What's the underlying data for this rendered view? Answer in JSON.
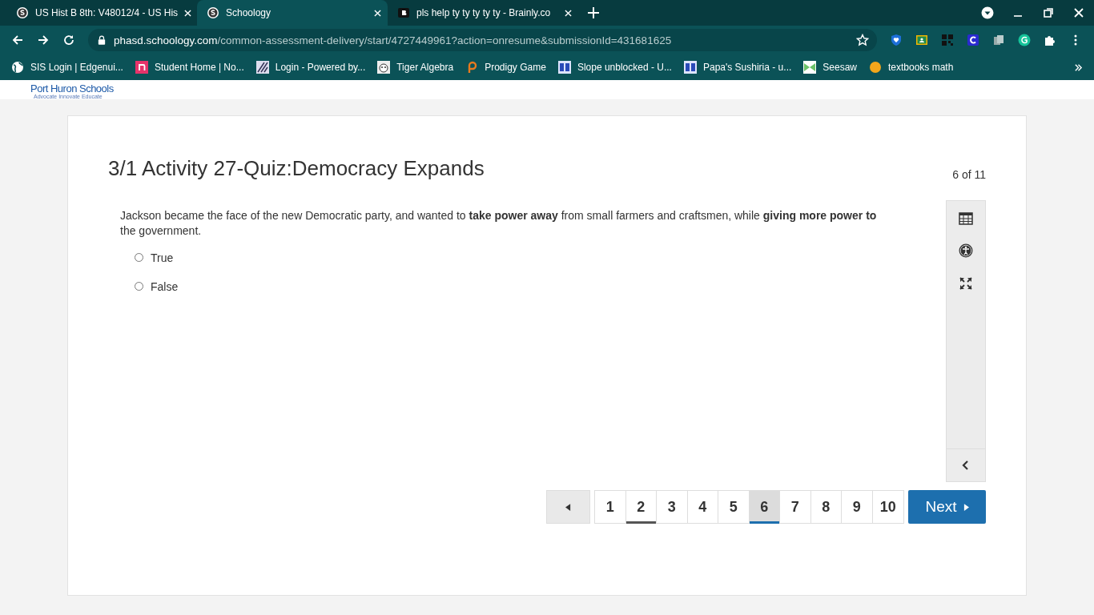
{
  "browser": {
    "tabs": [
      {
        "title": "US Hist B 8th: V48012/4 - US His",
        "selected": false
      },
      {
        "title": "Schoology",
        "selected": true
      },
      {
        "title": "pls help ty ty ty ty ty - Brainly.co",
        "selected": false
      }
    ],
    "url_host": "phasd.schoology.com",
    "url_path": "/common-assessment-delivery/start/4727449961?action=onresume&submissionId=431681625",
    "bookmarks": [
      {
        "label": "SIS Login | Edgenui..."
      },
      {
        "label": "Student Home | No..."
      },
      {
        "label": "Login - Powered by..."
      },
      {
        "label": "Tiger Algebra"
      },
      {
        "label": "Prodigy Game"
      },
      {
        "label": "Slope unblocked - U..."
      },
      {
        "label": "Papa's Sushiria - u..."
      },
      {
        "label": "Seesaw"
      },
      {
        "label": "textbooks math"
      }
    ]
  },
  "header": {
    "school": "Port Huron Schools",
    "motto": "Advocate  Innovate  Educate"
  },
  "quiz": {
    "title": "3/1 Activity 27-Quiz:Democracy Expands",
    "progress": "6 of 11",
    "question": "Jackson became the face of the new Democratic party, and wanted to **take power away** from small farmers and craftsmen, while **giving more power to** the government.",
    "options": [
      {
        "label": "True",
        "selected": false
      },
      {
        "label": "False",
        "selected": false
      }
    ],
    "pages": [
      {
        "label": "1",
        "selected": false,
        "marked": false
      },
      {
        "label": "2",
        "selected": false,
        "marked": true
      },
      {
        "label": "3",
        "selected": false,
        "marked": false
      },
      {
        "label": "4",
        "selected": false,
        "marked": false
      },
      {
        "label": "5",
        "selected": false,
        "marked": false
      },
      {
        "label": "6",
        "selected": true,
        "marked": false
      },
      {
        "label": "7",
        "selected": false,
        "marked": false
      },
      {
        "label": "8",
        "selected": false,
        "marked": false
      },
      {
        "label": "9",
        "selected": false,
        "marked": false
      },
      {
        "label": "10",
        "selected": false,
        "marked": false
      }
    ],
    "next": "Next"
  }
}
